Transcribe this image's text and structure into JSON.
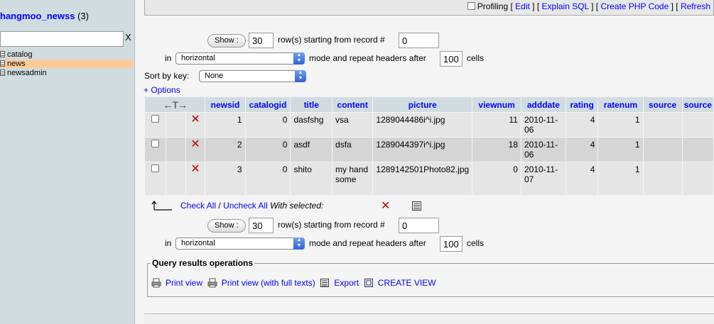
{
  "sidebar": {
    "db_name": "hangmoo_newss",
    "db_count": "(3)",
    "filter_value": "",
    "filter_clear": "X",
    "tables": [
      "catalog",
      "news",
      "newsadmin"
    ]
  },
  "topbar": {
    "profiling": "Profiling",
    "edit": "Edit",
    "explain_sql": "Explain SQL",
    "create_php": "Create PHP Code",
    "refresh": "Refresh"
  },
  "nav_top": {
    "show": "Show :",
    "rows": "30",
    "rows_label": "row(s) starting from record #",
    "start": "0",
    "in": "in",
    "mode": "horizontal",
    "mode_label": "mode and repeat headers after",
    "repeat": "100",
    "cells": "cells"
  },
  "sort": {
    "label": "Sort by key:",
    "value": "None"
  },
  "options_link": "+ Options",
  "table": {
    "headers": [
      "newsid",
      "catalogid",
      "title",
      "content",
      "picture",
      "viewnum",
      "adddate",
      "rating",
      "ratenum",
      "source",
      "source"
    ],
    "rows": [
      [
        "1",
        "0",
        "dasfshg",
        "vsa",
        "1289044486i^i.jpg",
        "11",
        "2010-11-06",
        "4",
        "1",
        "",
        ""
      ],
      [
        "2",
        "0",
        "asdf",
        "dsfa",
        "1289044397i^i.jpg",
        "18",
        "2010-11-06",
        "4",
        "1",
        "",
        ""
      ],
      [
        "3",
        "0",
        "shito",
        "my hand some",
        "1289142501Photo82.jpg",
        "0",
        "2010-11-07",
        "4",
        "1",
        "",
        ""
      ]
    ]
  },
  "with_selected": {
    "check_all": "Check All",
    "sep": "/",
    "uncheck_all": "Uncheck All",
    "label": "With selected:"
  },
  "nav_bottom": {
    "show": "Show :",
    "rows": "30",
    "rows_label": "row(s) starting from record #",
    "start": "0",
    "in": "in",
    "mode": "horizontal",
    "mode_label": "mode and repeat headers after",
    "repeat": "100",
    "cells": "cells"
  },
  "query_ops": {
    "title": "Query results operations",
    "print_view": "Print view",
    "print_full": "Print view (with full texts)",
    "export": "Export",
    "create_view": "CREATE VIEW"
  },
  "colors": {
    "link": "#0000ff",
    "header_bg": "#d0dce0",
    "active_row": "#ffcc99",
    "delete": "#cc0000"
  }
}
